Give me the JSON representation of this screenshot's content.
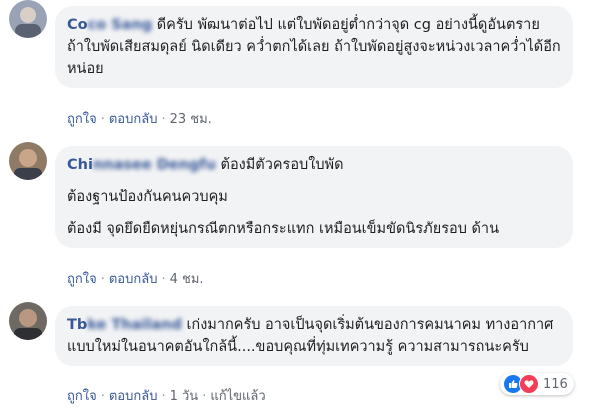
{
  "comments": [
    {
      "name_visible": "Co",
      "name_blurred": "co Sang",
      "first_line": "ดีครับ พัฒนาต่อไป",
      "paragraphs": [
        "แต่ใบพัดอยู่ต่ำกว่าจุด cg อย่างนี้ดูอันตราย ถ้าใบพัดเสียสมดุลย์ นิดเดียว คว่ำตกได้เลย ถ้าใบพัดอยู่สูงจะหน่วงเวลาคว่ำได้อีก หน่อย"
      ],
      "like": "ถูกใจ",
      "reply": "ตอบกลับ",
      "time": "23 ชม."
    },
    {
      "name_visible": "Chi",
      "name_blurred": "nnasee Dengfu",
      "first_line": "ต้องมีตัวครอบใบพัด",
      "paragraphs": [
        "ต้องฐานป้องกันคนควบคุม",
        "ต้องมี จุดยึดยืดหยุ่นกรณีตกหรือกระแทก เหมือนเข็มขัดนิรภัยรอบ ด้าน"
      ],
      "like": "ถูกใจ",
      "reply": "ตอบกลับ",
      "time": "4 ชม."
    },
    {
      "name_visible": "Tb",
      "name_blurred": "ke Thailand",
      "first_line": "เก่งมากครับ อาจเป็นจุดเริ่มต้นของการคมนาคม",
      "paragraphs": [
        "ทางอากาศแบบใหม่ในอนาคตอันใกล้นี้....ขอบคุณที่ทุ่มเทความรู้ ความสามารถนะครับ"
      ],
      "like": "ถูกใจ",
      "reply": "ตอบกลับ",
      "time": "1 วัน",
      "edited": "แก้ไขแล้ว",
      "reaction_count": "116"
    }
  ],
  "colors": {
    "link": "#385898",
    "bubble": "#f2f3f5",
    "like_blue": "#1877f2",
    "love_red": "#f33e58"
  }
}
